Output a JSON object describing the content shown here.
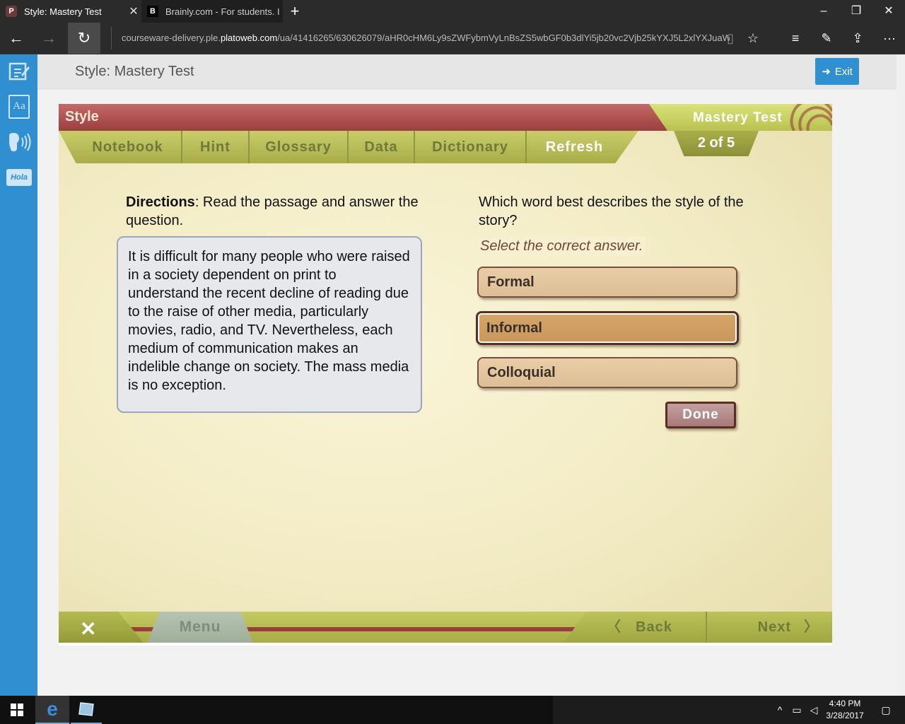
{
  "browser": {
    "tabs": [
      {
        "title": "Style: Mastery Test",
        "favicon": "plato-icon",
        "active": true
      },
      {
        "title": "Brainly.com - For students. I",
        "favicon": "brainly-icon",
        "active": false
      }
    ],
    "address": {
      "prefix": "courseware-delivery.ple.",
      "domain": "platoweb.com",
      "path": "/ua/41416265/630626079/aHR0cHM6Ly9sZWFybmVyLnBsZS5wbGF0b3dlYi5jb20vc2Vjb25kYXJ5L2xlYXJuaW"
    }
  },
  "header": {
    "title": "Style: Mastery Test",
    "exit_label": "Exit"
  },
  "sidebar": {
    "items": [
      {
        "icon": "notepad-icon"
      },
      {
        "icon": "dictionary-icon",
        "text": "Aa"
      },
      {
        "icon": "text-to-speech-icon"
      },
      {
        "icon": "translate-icon",
        "text": "Hola"
      }
    ]
  },
  "activity": {
    "section_title": "Style",
    "mode_label": "Mastery Test",
    "progress": "2 of 5",
    "tools": [
      "Notebook",
      "Hint",
      "Glossary",
      "Data",
      "Dictionary",
      "Refresh"
    ],
    "directions_label": "Directions",
    "directions_text": ": Read the passage and answer the question.",
    "passage": "It is difficult for many people who were raised in a society dependent on print to understand the recent decline of reading due to the raise of other media, particularly movies, radio, and TV. Nevertheless, each medium of communication makes an indelible change on society. The mass media is no exception.",
    "question": "Which word best describes the style of the story?",
    "instruction": "Select the correct answer.",
    "choices": [
      "Formal",
      "Informal",
      "Colloquial"
    ],
    "selected_choice": "Informal",
    "done_label": "Done",
    "menu_label": "Menu",
    "back_label": "Back",
    "next_label": "Next"
  },
  "taskbar": {
    "time": "4:40 PM",
    "date": "3/28/2017"
  },
  "colors": {
    "sidebar_blue": "#2f8fd0",
    "title_red": "#9a3e3e",
    "toolbar_green": "#a9ad48",
    "selected_choice": "#c9975b"
  }
}
